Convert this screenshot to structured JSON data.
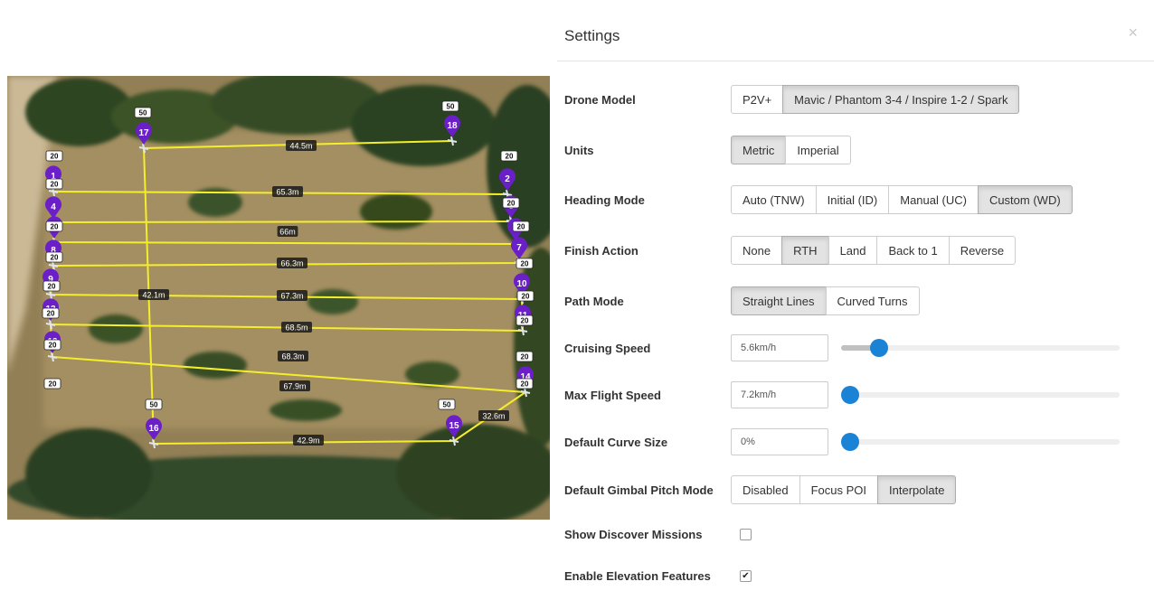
{
  "dialog": {
    "title": "Settings",
    "close_glyph": "×",
    "drone_model": {
      "label": "Drone Model",
      "options": [
        "P2V+",
        "Mavic / Phantom 3-4 / Inspire 1-2 / Spark"
      ],
      "selected": 1
    },
    "units": {
      "label": "Units",
      "options": [
        "Metric",
        "Imperial"
      ],
      "selected": 0
    },
    "heading_mode": {
      "label": "Heading Mode",
      "options": [
        "Auto (TNW)",
        "Initial (ID)",
        "Manual (UC)",
        "Custom (WD)"
      ],
      "selected": 3
    },
    "finish_action": {
      "label": "Finish Action",
      "options": [
        "None",
        "RTH",
        "Land",
        "Back to 1",
        "Reverse"
      ],
      "selected": 1
    },
    "path_mode": {
      "label": "Path Mode",
      "options": [
        "Straight Lines",
        "Curved Turns"
      ],
      "selected": 0
    },
    "cruising_speed": {
      "label": "Cruising Speed",
      "value": "5.6km/h",
      "slider_fraction": 0.11
    },
    "max_flight_speed": {
      "label": "Max Flight Speed",
      "value": "7.2km/h",
      "slider_fraction": 0.0
    },
    "default_curve_size": {
      "label": "Default Curve Size",
      "value": "0%",
      "slider_fraction": 0.0
    },
    "gimbal_pitch_mode": {
      "label": "Default Gimbal Pitch Mode",
      "options": [
        "Disabled",
        "Focus POI",
        "Interpolate"
      ],
      "selected": 2
    },
    "show_discover_missions": {
      "label": "Show Discover Missions",
      "checked": false,
      "check_glyph": ""
    },
    "enable_elevation_features": {
      "label": "Enable Elevation Features",
      "checked": true,
      "check_glyph": "✔"
    }
  },
  "map": {
    "colors": {
      "path": "#f5ee2a",
      "marker": "#6b1fc9",
      "label_bg": "#1a1a1a"
    },
    "altitude_labels": [
      "50",
      "50",
      "20",
      "20",
      "20",
      "20",
      "20",
      "20",
      "20",
      "20",
      "20",
      "20",
      "20",
      "20",
      "20",
      "20",
      "20",
      "20",
      "50",
      "50"
    ],
    "waypoint_numbers": [
      "1",
      "2",
      "3",
      "4",
      "5",
      "6",
      "7",
      "8",
      "9",
      "10",
      "11",
      "12",
      "13",
      "14",
      "15",
      "16",
      "17",
      "18"
    ],
    "distance_labels": [
      "44.5m",
      "65.3m",
      "66m",
      "66.3m",
      "67.3m",
      "68.5m",
      "68.3m",
      "67.9m",
      "42.9m",
      "42.1m",
      "32.6m"
    ]
  }
}
